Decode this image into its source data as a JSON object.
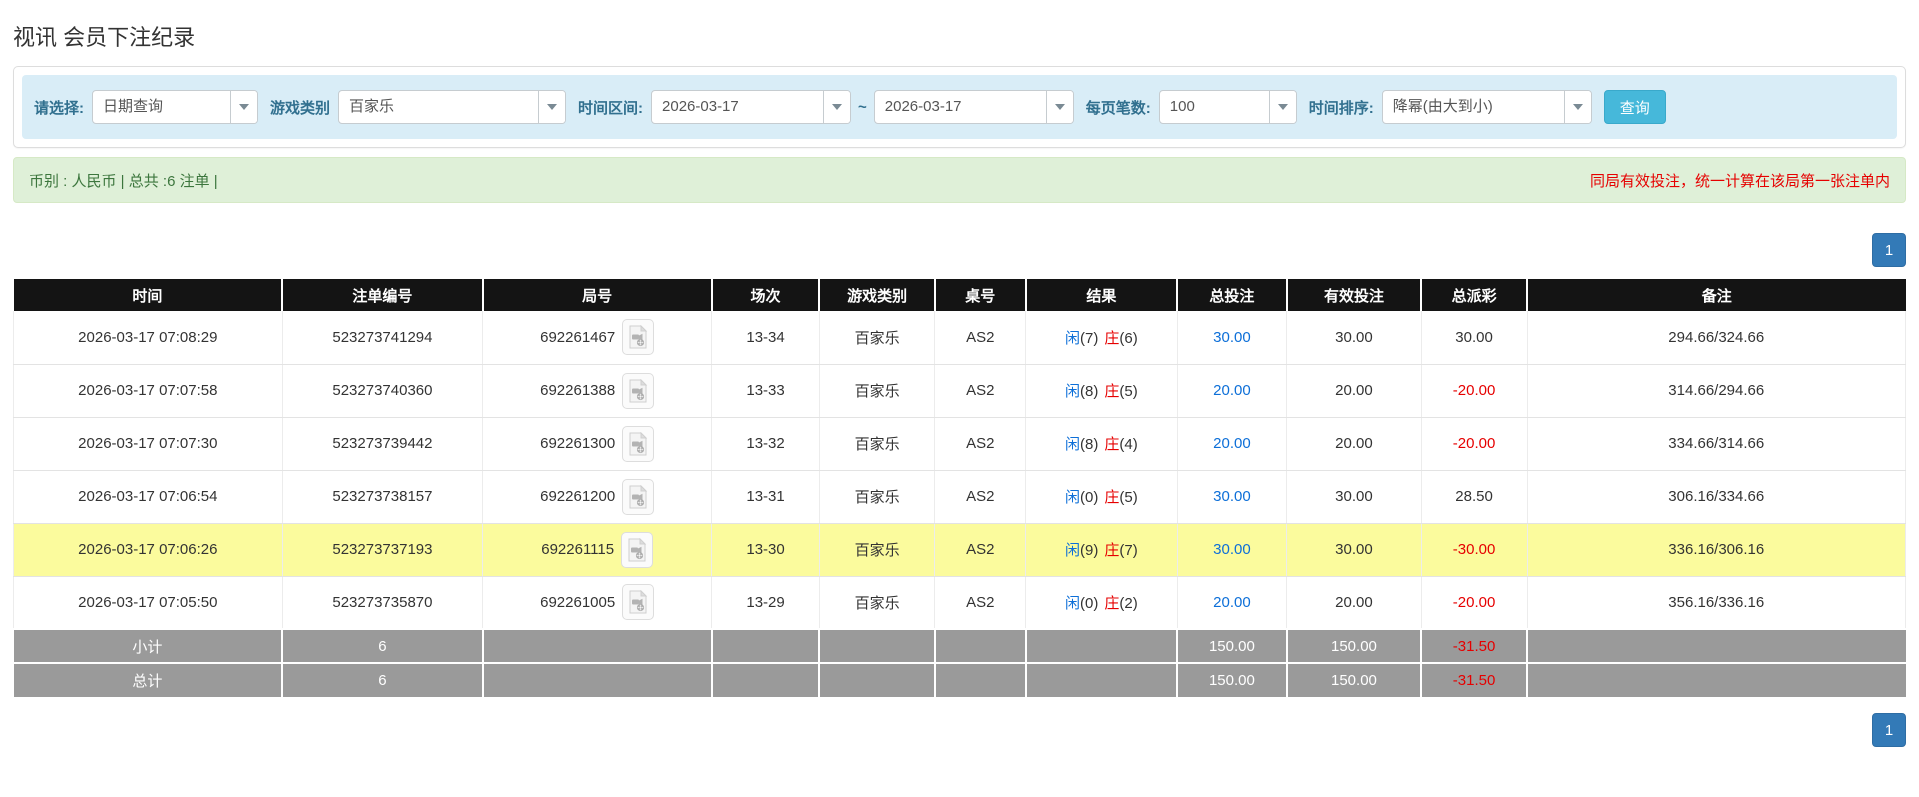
{
  "page": {
    "title": "视讯 会员下注纪录"
  },
  "filters": {
    "select_label": "请选择:",
    "select_value": "日期查询",
    "game_label": "游戏类别",
    "game_value": "百家乐",
    "range_label": "时间区间:",
    "date_from": "2026-03-17",
    "range_separator": "~",
    "date_to": "2026-03-17",
    "per_page_label": "每页笔数:",
    "per_page_value": "100",
    "sort_label": "时间排序:",
    "sort_value": "降幂(由大到小)",
    "search_button_label": "查询"
  },
  "summary": {
    "left_text": "币别 : 人民币 | 总共 :6 注单 |",
    "right_text": "同局有效投注，统一计算在该局第一张注单内"
  },
  "pagination": {
    "page": "1"
  },
  "icons": {
    "dropdown_caret": "chevron-down-icon",
    "round_video": "film-file-icon"
  },
  "colors": {
    "filter_bg": "#d9edf7",
    "filter_label": "#31708f",
    "search_button": "#46b8da",
    "summary_bg": "#dff0d8",
    "summary_text": "#3c763d",
    "warning_red": "#e60000",
    "header_bg": "#141414",
    "pager_blue": "#337ab7",
    "row_highlight": "#fbfb9d",
    "footer_gray": "#9a9a9a",
    "bet_blue": "#0d6fd8",
    "player_blue": "#0d6fd8",
    "banker_red": "#e60000"
  },
  "table": {
    "headers": [
      "时间",
      "注单编号",
      "局号",
      "场次",
      "游戏类别",
      "桌号",
      "结果",
      "总投注",
      "有效投注",
      "总派彩",
      "备注"
    ],
    "rows": [
      {
        "time": "2026-03-17 07:08:29",
        "bet_no": "523273741294",
        "round_no": "692261467",
        "session": "13-34",
        "game": "百家乐",
        "table_no": "AS2",
        "result": {
          "player": "闲",
          "player_pts": "(7)",
          "banker": "庄",
          "banker_pts": "(6)"
        },
        "total_bet": "30.00",
        "valid_bet": "30.00",
        "payout": "30.00",
        "note": "294.66/324.66",
        "highlight": false
      },
      {
        "time": "2026-03-17 07:07:58",
        "bet_no": "523273740360",
        "round_no": "692261388",
        "session": "13-33",
        "game": "百家乐",
        "table_no": "AS2",
        "result": {
          "player": "闲",
          "player_pts": "(8)",
          "banker": "庄",
          "banker_pts": "(5)"
        },
        "total_bet": "20.00",
        "valid_bet": "20.00",
        "payout": "-20.00",
        "note": "314.66/294.66",
        "highlight": false
      },
      {
        "time": "2026-03-17 07:07:30",
        "bet_no": "523273739442",
        "round_no": "692261300",
        "session": "13-32",
        "game": "百家乐",
        "table_no": "AS2",
        "result": {
          "player": "闲",
          "player_pts": "(8)",
          "banker": "庄",
          "banker_pts": "(4)"
        },
        "total_bet": "20.00",
        "valid_bet": "20.00",
        "payout": "-20.00",
        "note": "334.66/314.66",
        "highlight": false
      },
      {
        "time": "2026-03-17 07:06:54",
        "bet_no": "523273738157",
        "round_no": "692261200",
        "session": "13-31",
        "game": "百家乐",
        "table_no": "AS2",
        "result": {
          "player": "闲",
          "player_pts": "(0)",
          "banker": "庄",
          "banker_pts": "(5)"
        },
        "total_bet": "30.00",
        "valid_bet": "30.00",
        "payout": "28.50",
        "note": "306.16/334.66",
        "highlight": false
      },
      {
        "time": "2026-03-17 07:06:26",
        "bet_no": "523273737193",
        "round_no": "692261115",
        "session": "13-30",
        "game": "百家乐",
        "table_no": "AS2",
        "result": {
          "player": "闲",
          "player_pts": "(9)",
          "banker": "庄",
          "banker_pts": "(7)"
        },
        "total_bet": "30.00",
        "valid_bet": "30.00",
        "payout": "-30.00",
        "note": "336.16/306.16",
        "highlight": true
      },
      {
        "time": "2026-03-17 07:05:50",
        "bet_no": "523273735870",
        "round_no": "692261005",
        "session": "13-29",
        "game": "百家乐",
        "table_no": "AS2",
        "result": {
          "player": "闲",
          "player_pts": "(0)",
          "banker": "庄",
          "banker_pts": "(2)"
        },
        "total_bet": "20.00",
        "valid_bet": "20.00",
        "payout": "-20.00",
        "note": "356.16/336.16",
        "highlight": false
      }
    ],
    "footer": [
      {
        "label": "小计",
        "count": "6",
        "total_bet": "150.00",
        "valid_bet": "150.00",
        "payout": "-31.50"
      },
      {
        "label": "总计",
        "count": "6",
        "total_bet": "150.00",
        "valid_bet": "150.00",
        "payout": "-31.50"
      }
    ]
  }
}
